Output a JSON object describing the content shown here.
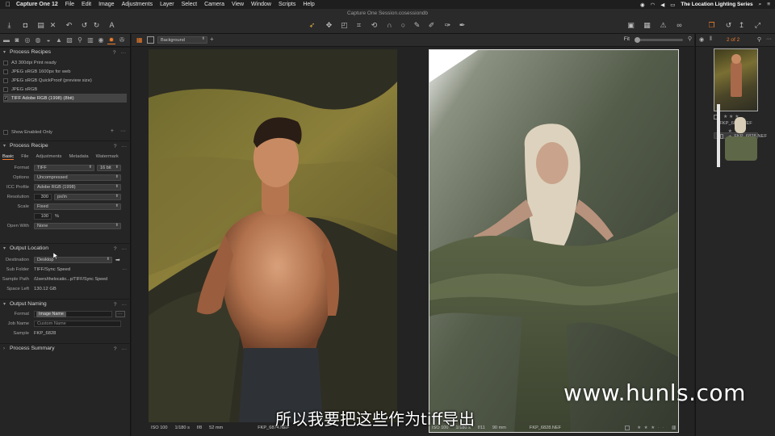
{
  "menubar": {
    "app": "Capture One 12",
    "items": [
      "File",
      "Edit",
      "Image",
      "Adjustments",
      "Layer",
      "Select",
      "Camera",
      "View",
      "Window",
      "Scripts",
      "Help"
    ],
    "right_title": "The Location Lighting Series"
  },
  "toolbar": {
    "document_title": "Capture One Session.cosessiondb"
  },
  "process_recipes": {
    "title": "Process Recipes",
    "items": [
      {
        "label": "A3 300dpi Print ready",
        "checked": false
      },
      {
        "label": "JPEG sRGB 1600px for web",
        "checked": false
      },
      {
        "label": "JPEG sRGB QuickProof (preview size)",
        "checked": false
      },
      {
        "label": "JPEG sRGB",
        "checked": false
      },
      {
        "label": "TIFF Adobe RGB (1998) (8bit)",
        "checked": true
      }
    ],
    "show_enabled_only": "Show Enabled Only"
  },
  "process_recipe": {
    "title": "Process Recipe",
    "tabs": [
      "Basic",
      "File",
      "Adjustments",
      "Metadata",
      "Watermark"
    ],
    "active_tab": "Basic",
    "format_label": "Format",
    "format_value": "TIFF",
    "bit_value": "16 bit",
    "options_label": "Options",
    "options_value": "Uncompressed",
    "icc_label": "ICC Profile",
    "icc_value": "Adobe RGB (1998)",
    "resolution_label": "Resolution",
    "resolution_value": "300",
    "resolution_unit": "px/in",
    "scale_label": "Scale",
    "scale_value": "Fixed",
    "scale_pct": "100",
    "scale_pct_unit": "%",
    "open_with_label": "Open With",
    "open_with_value": "None"
  },
  "output_location": {
    "title": "Output Location",
    "destination_label": "Destination",
    "destination_value": "Desktop",
    "subfolder_label": "Sub Folder",
    "subfolder_value": "TIFF/Sync Speed",
    "sample_path_label": "Sample Path",
    "sample_path_value": "/Users/thelocatio...p/TIFF/Sync Speed",
    "space_left_label": "Space Left",
    "space_left_value": "130.12 GB"
  },
  "output_naming": {
    "title": "Output Naming",
    "format_label": "Format",
    "format_token": "Image Name",
    "job_name_label": "Job Name",
    "job_name_placeholder": "Custom Name",
    "sample_label": "Sample",
    "sample_value": "FKP_6828"
  },
  "process_summary": {
    "title": "Process Summary"
  },
  "viewer": {
    "background_select": "Background",
    "fit_label": "Fit",
    "photos": [
      {
        "iso": "ISO 100",
        "shutter": "1/180 s",
        "aperture": "f/8",
        "focal": "52 mm",
        "filename": "FKP_6874.NEF"
      },
      {
        "iso": "ISO 100",
        "shutter": "1/180 s",
        "aperture": "f/11",
        "focal": "90 mm",
        "filename": "FKP_6828.NEF"
      }
    ],
    "stars": "★ ★ ★ · ·"
  },
  "browser": {
    "count": "2 of 2",
    "thumbs": [
      {
        "filename": "FKP_6874.NEF",
        "stars": "★ ★ ★"
      },
      {
        "filename": "FKP_6828.NEF",
        "stars": "★ ★ ★"
      }
    ]
  },
  "overlay": {
    "subtitle": "所以我要把这些作为tiff导出",
    "watermark": "www.hunls.com"
  },
  "colors": {
    "accent": "#ef7d2c",
    "panel": "#252525",
    "viewer": "#232323"
  }
}
